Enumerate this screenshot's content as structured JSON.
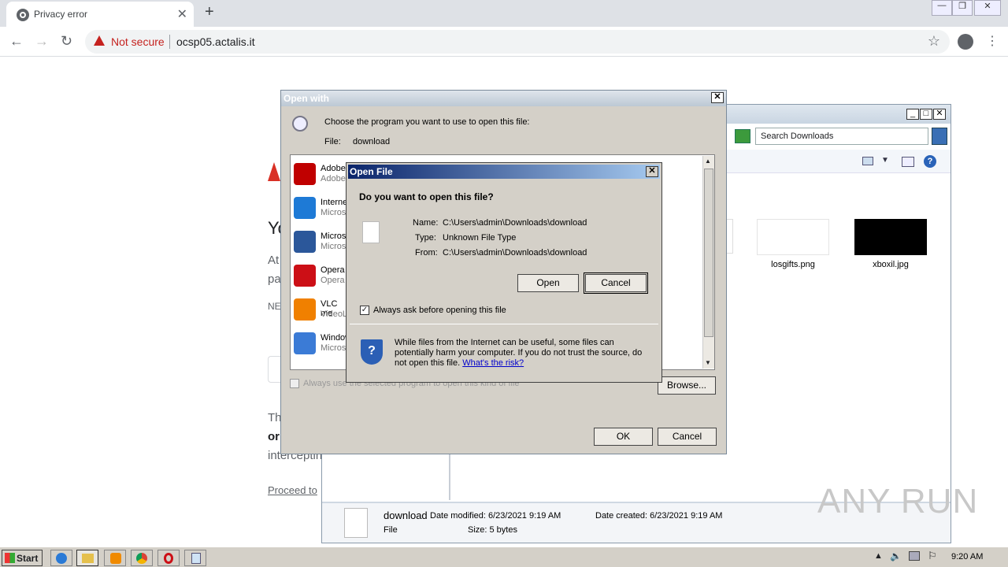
{
  "browser": {
    "tab_title": "Privacy error",
    "not_secure": "Not secure",
    "url": "ocsp05.actalis.it"
  },
  "privacy_page": {
    "heading_fragment": "Yo",
    "line1_fragment": "At",
    "line2_fragment": "pa",
    "net_fragment": "NE",
    "body1_fragment": "Th",
    "body2_fragment": "or",
    "body3_fragment": "interceptin",
    "proceed_link": "Proceed to"
  },
  "explorer": {
    "search_placeholder": "Search Downloads",
    "files": [
      {
        "name": "losgifts.png"
      },
      {
        "name": "xboxil.jpg"
      }
    ],
    "details": {
      "filename": "download",
      "date_modified": "Date modified: 6/23/2021 9:19 AM",
      "date_created": "Date created: 6/23/2021 9:19 AM",
      "type": "File",
      "size": "Size: 5 bytes"
    }
  },
  "open_with": {
    "title": "Open with",
    "prompt": "Choose the program you want to use to open this file:",
    "file_label": "File:",
    "file_value": "download",
    "apps": [
      {
        "name": "Adobe",
        "sub": "Adobe",
        "color": "#c00000"
      },
      {
        "name": "Interne",
        "sub": "Micros",
        "color": "#1e7ad6"
      },
      {
        "name": "Micros",
        "sub": "Micros",
        "color": "#2b579a"
      },
      {
        "name": "Opera",
        "sub": "Opera",
        "color": "#cc0f16"
      },
      {
        "name": "VLC me",
        "sub": "VideoL",
        "color": "#f08000"
      },
      {
        "name": "Window",
        "sub": "Micros",
        "color": "#3b7bd6"
      }
    ],
    "always_use_label": "Always use the selected program to open this kind of file",
    "browse_label": "Browse...",
    "ok_label": "OK",
    "cancel_label": "Cancel"
  },
  "open_file": {
    "title": "Open File",
    "question": "Do you want to open this file?",
    "name_label": "Name:",
    "name_value": "C:\\Users\\admin\\Downloads\\download",
    "type_label": "Type:",
    "type_value": "Unknown File Type",
    "from_label": "From:",
    "from_value": "C:\\Users\\admin\\Downloads\\download",
    "open_label": "Open",
    "cancel_label": "Cancel",
    "always_ask_label": "Always ask before opening this file",
    "warning_text": "While files from the Internet can be useful, some files can potentially harm your computer. If you do not trust the source, do not open this file.",
    "risk_link": "What's the risk?"
  },
  "taskbar": {
    "start_label": "Start",
    "clock": "9:20 AM"
  },
  "watermark": "ANY RUN"
}
